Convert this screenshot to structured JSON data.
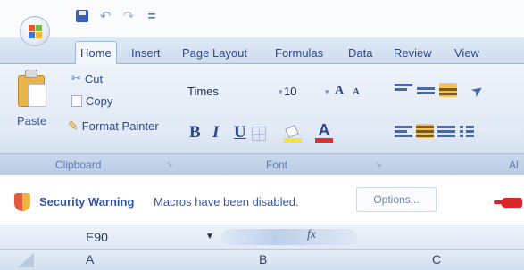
{
  "quick_access": {
    "office_button_icon": "office-logo-icon",
    "save_icon": "save-icon",
    "undo_icon": "undo-icon",
    "redo_icon": "redo-icon",
    "customize_icon": "customize-qat-icon"
  },
  "tabs": [
    "Home",
    "Insert",
    "Page Layout",
    "Formulas",
    "Data",
    "Review",
    "View"
  ],
  "active_tab": "Home",
  "clipboard": {
    "paste_label": "Paste",
    "cut_label": "Cut",
    "copy_label": "Copy",
    "format_painter_label": "Format Painter",
    "group_label": "Clipboard"
  },
  "font": {
    "font_name": "Times",
    "font_size": "10",
    "grow_label": "A",
    "shrink_label": "A",
    "bold_label": "B",
    "italic_label": "I",
    "underline_label": "U",
    "font_color_label": "A",
    "fill_color": "#f5e33a",
    "text_color": "#e0302b",
    "group_label": "Font"
  },
  "alignment": {
    "group_label_partial": "Al"
  },
  "security_bar": {
    "title": "Security Warning",
    "message": "Macros have been disabled.",
    "options_label": "Options..."
  },
  "formula_bar": {
    "name_box": "E90",
    "fx_label": "fx"
  },
  "columns": [
    "A",
    "B",
    "C"
  ]
}
